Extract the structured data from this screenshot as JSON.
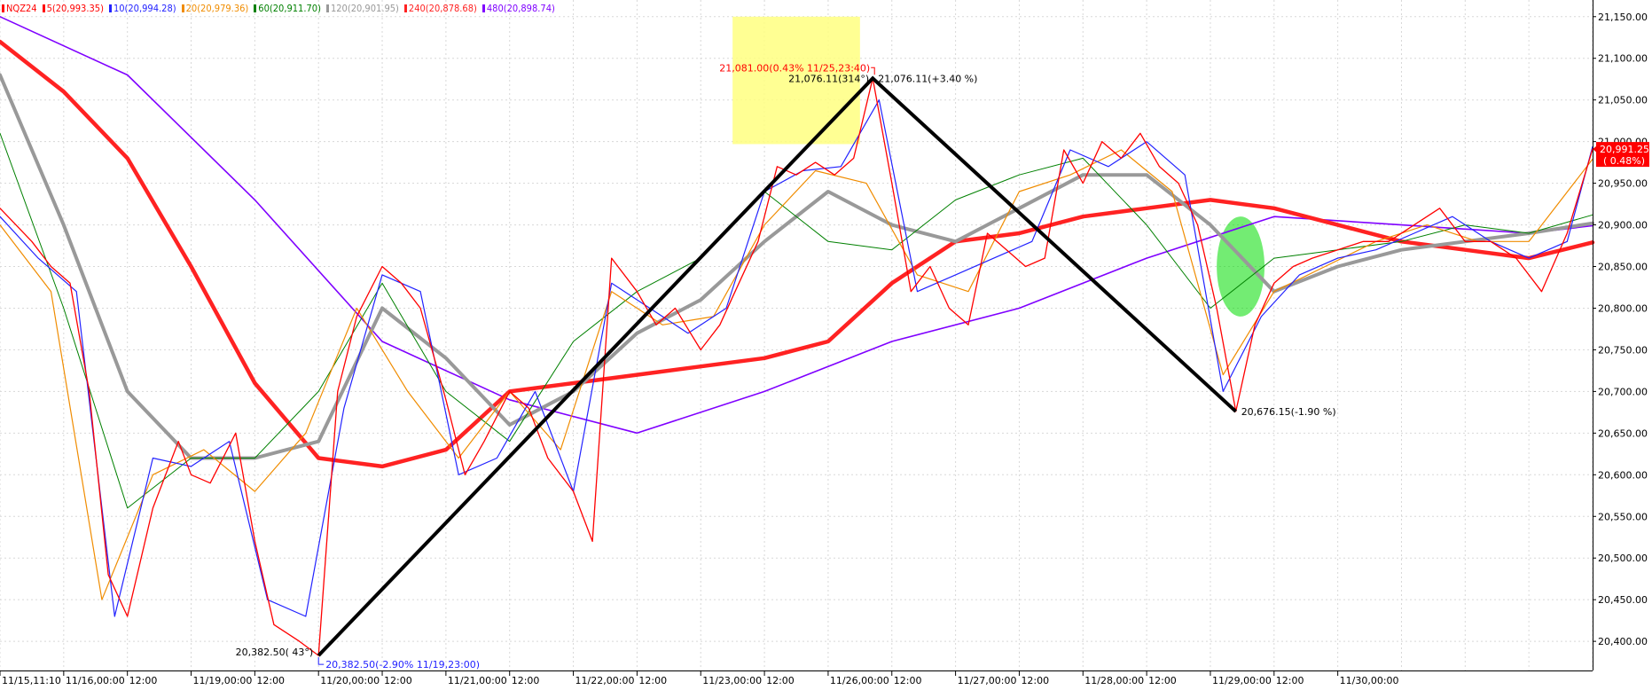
{
  "legend": [
    {
      "label": "NQZ24",
      "color": "#ff0000"
    },
    {
      "label": "5(20,993.35)",
      "color": "#ff0000"
    },
    {
      "label": "10(20,994.28)",
      "color": "#2222ff"
    },
    {
      "label": "20(20,979.36)",
      "color": "#f08c00"
    },
    {
      "label": "60(20,911.70)",
      "color": "#008000"
    },
    {
      "label": "120(20,901.95)",
      "color": "#999999"
    },
    {
      "label": "240(20,878.68)",
      "color": "#ff2222"
    },
    {
      "label": "480(20,898.74)",
      "color": "#7f00ff"
    }
  ],
  "annotations": {
    "peak_high_label": "21,081.00(0.43% 11/25,23:40)",
    "peak_left_label": "21,076.11(314°)",
    "peak_right_label": "21,076.11(+3.40 %)",
    "low_left_label": "20,382.50( 43°)",
    "low_bottom_label": "20,382.50(-2.90% 11/19,23:00)",
    "trough_label": "20,676.15(-1.90 %)",
    "current_price": "20,991.25",
    "current_change": "( 0.48%)"
  },
  "chart_data": {
    "type": "line",
    "title": "",
    "symbol": "NQZ24",
    "ylim": [
      20365,
      21170
    ],
    "yticks": [
      20400,
      20450,
      20500,
      20550,
      20600,
      20650,
      20700,
      20750,
      20800,
      20850,
      20900,
      20950,
      21000,
      21050,
      21100,
      21150
    ],
    "ytick_labels": [
      "20,400.00",
      "20,450.00",
      "20,500.00",
      "20,550.00",
      "20,600.00",
      "20,650.00",
      "20,700.00",
      "20,750.00",
      "20,800.00",
      "20,850.00",
      "20,900.00",
      "20,950.00",
      "21,000.00",
      "21,050.00",
      "21,100.00",
      "21,150.00"
    ],
    "xlim": [
      0,
      2.5
    ],
    "x_unit": "trading sessions since 11/15 11:10",
    "xticks": [
      0,
      0.1,
      0.2,
      0.3,
      0.4,
      0.5,
      0.6,
      0.7,
      0.8,
      0.9,
      1.0,
      1.1,
      1.2,
      1.3,
      1.4,
      1.5,
      1.6,
      1.7,
      1.8,
      1.9,
      2.0,
      2.1,
      2.2,
      2.3,
      2.4,
      2.5
    ],
    "xtick_labels": [
      "11/15,11:10",
      "11/16,00:00",
      "12:00",
      "11/19,00:00",
      "12:00",
      "11/20,00:00",
      "12:00",
      "11/21,00:00",
      "12:00",
      "11/22,00:00",
      "12:00",
      "11/23,00:00",
      "12:00",
      "11/26,00:00",
      "12:00",
      "11/27,00:00",
      "12:00",
      "11/28,00:00",
      "12:00",
      "11/29,00:00",
      "12:00",
      "11/30,00:00"
    ],
    "grid": true,
    "series": [
      {
        "name": "NQZ24",
        "color": "#ff0000",
        "x": [
          0,
          0.05,
          0.08,
          0.11,
          0.14,
          0.17,
          0.2,
          0.24,
          0.28,
          0.3,
          0.33,
          0.37,
          0.4,
          0.43,
          0.47,
          0.5,
          0.53,
          0.56,
          0.6,
          0.63,
          0.66,
          0.7,
          0.73,
          0.76,
          0.8,
          0.83,
          0.86,
          0.9,
          0.93,
          0.96,
          1.0,
          1.03,
          1.06,
          1.1,
          1.13,
          1.16,
          1.19,
          1.22,
          1.25,
          1.28,
          1.31,
          1.34,
          1.37,
          1.4,
          1.43,
          1.46,
          1.49,
          1.52,
          1.55,
          1.58,
          1.61,
          1.64,
          1.67,
          1.7,
          1.73,
          1.76,
          1.79,
          1.82,
          1.85,
          1.88,
          1.91,
          1.94,
          1.97,
          2.0,
          2.03,
          2.06,
          2.1,
          2.14,
          2.18,
          2.22,
          2.26,
          2.3,
          2.34,
          2.38,
          2.42,
          2.46,
          2.5
        ],
        "y": [
          20920,
          20880,
          20850,
          20830,
          20700,
          20480,
          20430,
          20560,
          20640,
          20600,
          20590,
          20650,
          20520,
          20420,
          20400,
          20383,
          20700,
          20790,
          20850,
          20830,
          20800,
          20690,
          20600,
          20640,
          20700,
          20680,
          20620,
          20580,
          20520,
          20860,
          20820,
          20780,
          20800,
          20750,
          20780,
          20830,
          20880,
          20970,
          20960,
          20975,
          20960,
          20980,
          21076,
          20950,
          20820,
          20850,
          20800,
          20780,
          20890,
          20870,
          20850,
          20860,
          20990,
          20950,
          21000,
          20980,
          21010,
          20970,
          20950,
          20900,
          20800,
          20676,
          20780,
          20830,
          20850,
          20860,
          20870,
          20880,
          20880,
          20900,
          20920,
          20880,
          20880,
          20860,
          20820,
          20890,
          20991
        ]
      },
      {
        "name": "480",
        "color": "#7f00ff",
        "x": [
          0,
          0.2,
          0.4,
          0.6,
          0.8,
          1.0,
          1.2,
          1.4,
          1.6,
          1.8,
          2.0,
          2.2,
          2.4,
          2.5
        ],
        "y": [
          21150,
          21080,
          20930,
          20760,
          20690,
          20650,
          20700,
          20760,
          20800,
          20860,
          20910,
          20900,
          20890,
          20899
        ]
      },
      {
        "name": "240",
        "color": "#ff2222",
        "x": [
          0,
          0.1,
          0.2,
          0.3,
          0.4,
          0.5,
          0.6,
          0.7,
          0.8,
          0.9,
          1.0,
          1.1,
          1.2,
          1.3,
          1.4,
          1.5,
          1.6,
          1.7,
          1.8,
          1.9,
          2.0,
          2.1,
          2.2,
          2.3,
          2.4,
          2.5
        ],
        "y": [
          21120,
          21060,
          20980,
          20850,
          20710,
          20620,
          20610,
          20630,
          20700,
          20710,
          20720,
          20730,
          20740,
          20760,
          20830,
          20880,
          20890,
          20910,
          20920,
          20930,
          20920,
          20900,
          20880,
          20870,
          20860,
          20879
        ]
      },
      {
        "name": "120",
        "color": "#999999",
        "x": [
          0,
          0.1,
          0.2,
          0.3,
          0.4,
          0.5,
          0.6,
          0.7,
          0.8,
          0.9,
          1.0,
          1.1,
          1.2,
          1.3,
          1.4,
          1.5,
          1.6,
          1.7,
          1.8,
          1.9,
          2.0,
          2.1,
          2.2,
          2.3,
          2.4,
          2.5
        ],
        "y": [
          21080,
          20900,
          20700,
          20620,
          20620,
          20640,
          20800,
          20740,
          20660,
          20700,
          20770,
          20810,
          20880,
          20940,
          20900,
          20880,
          20920,
          20960,
          20960,
          20900,
          20820,
          20850,
          20870,
          20880,
          20890,
          20902
        ]
      },
      {
        "name": "60",
        "color": "#008000",
        "x": [
          0,
          0.1,
          0.2,
          0.3,
          0.4,
          0.5,
          0.6,
          0.7,
          0.8,
          0.9,
          1.0,
          1.1,
          1.2,
          1.3,
          1.4,
          1.5,
          1.6,
          1.7,
          1.8,
          1.9,
          2.0,
          2.1,
          2.2,
          2.3,
          2.4,
          2.5
        ],
        "y": [
          21010,
          20800,
          20560,
          20620,
          20620,
          20700,
          20830,
          20700,
          20640,
          20760,
          20820,
          20860,
          20940,
          20880,
          20870,
          20930,
          20960,
          20980,
          20900,
          20800,
          20860,
          20870,
          20880,
          20900,
          20890,
          20912
        ]
      },
      {
        "name": "20",
        "color": "#f08c00",
        "x": [
          0,
          0.08,
          0.16,
          0.24,
          0.32,
          0.4,
          0.48,
          0.56,
          0.64,
          0.72,
          0.8,
          0.88,
          0.96,
          1.04,
          1.12,
          1.2,
          1.28,
          1.36,
          1.44,
          1.52,
          1.6,
          1.68,
          1.76,
          1.84,
          1.92,
          2.0,
          2.08,
          2.16,
          2.24,
          2.32,
          2.4,
          2.5
        ],
        "y": [
          20900,
          20820,
          20450,
          20600,
          20630,
          20580,
          20650,
          20800,
          20700,
          20620,
          20700,
          20630,
          20820,
          20780,
          20790,
          20900,
          20965,
          20950,
          20840,
          20820,
          20940,
          20960,
          20990,
          20940,
          20720,
          20820,
          20850,
          20880,
          20900,
          20880,
          20880,
          20979
        ]
      },
      {
        "name": "10",
        "color": "#2222ff",
        "x": [
          0,
          0.06,
          0.12,
          0.18,
          0.24,
          0.3,
          0.36,
          0.42,
          0.48,
          0.54,
          0.6,
          0.66,
          0.72,
          0.78,
          0.84,
          0.9,
          0.96,
          1.02,
          1.08,
          1.14,
          1.2,
          1.26,
          1.32,
          1.38,
          1.44,
          1.5,
          1.56,
          1.62,
          1.68,
          1.74,
          1.8,
          1.86,
          1.92,
          1.98,
          2.04,
          2.1,
          2.16,
          2.22,
          2.28,
          2.34,
          2.4,
          2.46,
          2.5
        ],
        "y": [
          20910,
          20860,
          20820,
          20430,
          20620,
          20610,
          20640,
          20450,
          20430,
          20680,
          20840,
          20820,
          20600,
          20620,
          20700,
          20580,
          20830,
          20800,
          20770,
          20800,
          20940,
          20965,
          20970,
          21050,
          20820,
          20840,
          20860,
          20880,
          20990,
          20970,
          21000,
          20960,
          20700,
          20790,
          20840,
          20860,
          20870,
          20890,
          20910,
          20880,
          20860,
          20880,
          20994
        ]
      }
    ]
  }
}
